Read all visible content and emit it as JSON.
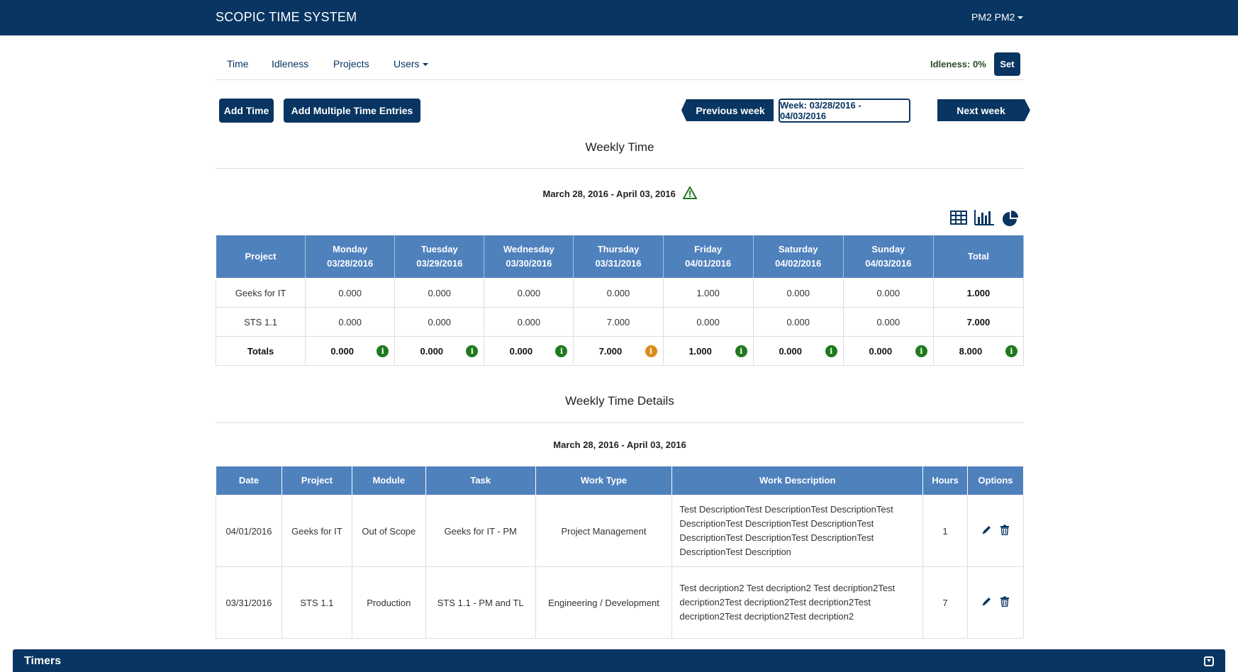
{
  "app": {
    "title": "SCOPIC TIME SYSTEM",
    "user": "PM2 PM2"
  },
  "nav": {
    "items": [
      "Time",
      "Idleness",
      "Projects",
      "Users"
    ],
    "idleness_label": "Idleness: 0%",
    "set_label": "Set"
  },
  "toolbar": {
    "add_time": "Add Time",
    "add_multiple": "Add Multiple Time Entries",
    "previous_week": "Previous week",
    "week_range": "Week: 03/28/2016 - 04/03/2016",
    "next_week": "Next week"
  },
  "weekly": {
    "title": "Weekly Time",
    "date_range": "March 28, 2016 - April 03, 2016",
    "view_icons": [
      "table-icon",
      "bar-chart-icon",
      "pie-chart-icon"
    ],
    "headers": [
      [
        "Project",
        ""
      ],
      [
        "Monday",
        "03/28/2016"
      ],
      [
        "Tuesday",
        "03/29/2016"
      ],
      [
        "Wednesday",
        "03/30/2016"
      ],
      [
        "Thursday",
        "03/31/2016"
      ],
      [
        "Friday",
        "04/01/2016"
      ],
      [
        "Saturday",
        "04/02/2016"
      ],
      [
        "Sunday",
        "04/03/2016"
      ],
      [
        "Total",
        ""
      ]
    ],
    "rows": [
      {
        "project": "Geeks for IT",
        "values": [
          "0.000",
          "0.000",
          "0.000",
          "0.000",
          "1.000",
          "0.000",
          "0.000"
        ],
        "total": "1.000"
      },
      {
        "project": "STS 1.1",
        "values": [
          "0.000",
          "0.000",
          "0.000",
          "7.000",
          "0.000",
          "0.000",
          "0.000"
        ],
        "total": "7.000"
      }
    ],
    "totals": {
      "label": "Totals",
      "values": [
        "0.000",
        "0.000",
        "0.000",
        "7.000",
        "1.000",
        "0.000",
        "0.000",
        "8.000"
      ],
      "badges": [
        "green",
        "green",
        "green",
        "orange",
        "green",
        "green",
        "green",
        "green"
      ]
    }
  },
  "details": {
    "title": "Weekly Time Details",
    "date_range": "March 28, 2016 - April 03, 2016",
    "headers": [
      "Date",
      "Project",
      "Module",
      "Task",
      "Work Type",
      "Work Description",
      "Hours",
      "Options"
    ],
    "rows": [
      {
        "date": "04/01/2016",
        "project": "Geeks for IT",
        "module": "Out of Scope",
        "task": "Geeks for IT - PM",
        "work_type": "Project Management",
        "description": "Test DescriptionTest DescriptionTest DescriptionTest DescriptionTest DescriptionTest DescriptionTest DescriptionTest DescriptionTest DescriptionTest DescriptionTest Description",
        "hours": "1"
      },
      {
        "date": "03/31/2016",
        "project": "STS 1.1",
        "module": "Production",
        "task": "STS 1.1 - PM and TL",
        "work_type": "Engineering / Development",
        "description": "Test decription2 Test decription2 Test decription2Test decription2Test decription2Test decription2Test decription2Test decription2Test decription2",
        "hours": "7"
      }
    ]
  },
  "timers": {
    "title": "Timers"
  },
  "colors": {
    "brand": "#083561",
    "table_header": "#4f81bd",
    "badge_ok": "#1f7a1f",
    "badge_warn": "#d98b1a"
  }
}
